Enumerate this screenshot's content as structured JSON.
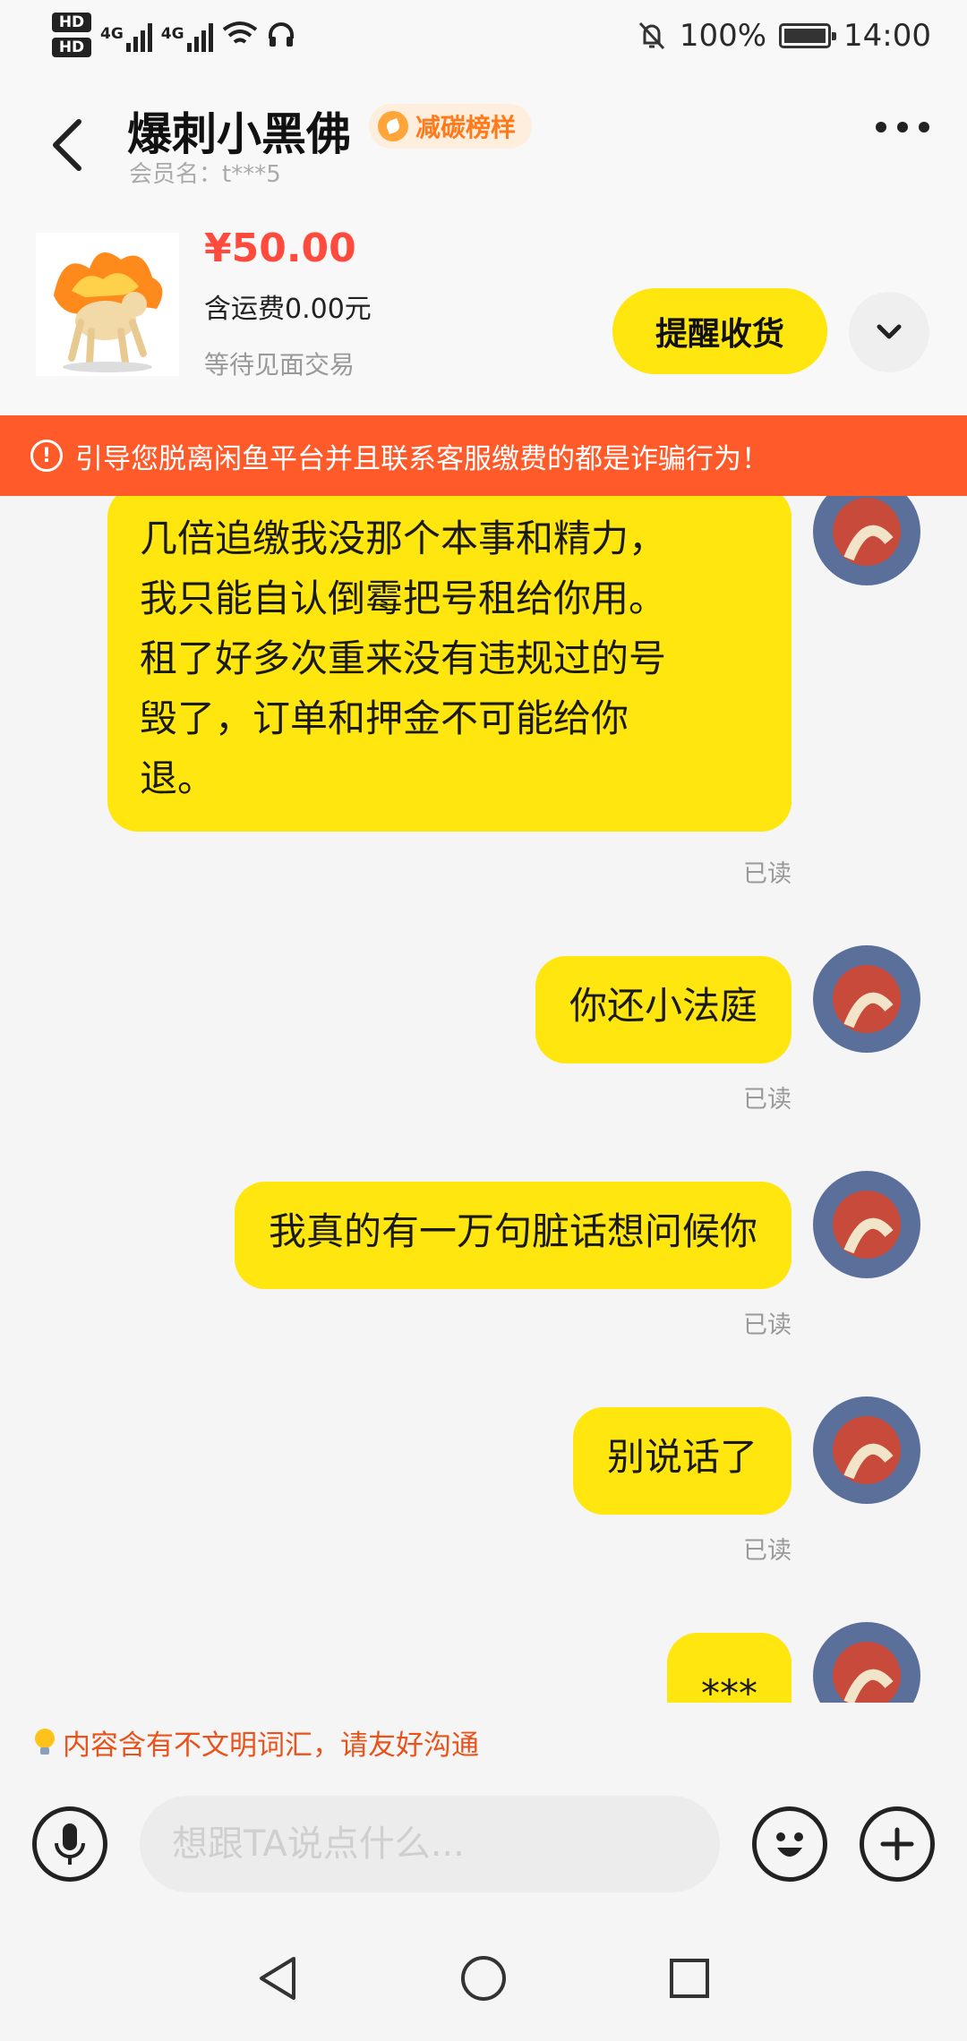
{
  "status_bar": {
    "hd1": "HD",
    "hd2": "HD",
    "net1": "4G",
    "net2": "4G",
    "battery": "100%",
    "time": "14:00"
  },
  "header": {
    "title": "爆刺小黑佛",
    "badge": "减碳榜样",
    "member_name": "会员名：t***5"
  },
  "product": {
    "price": "¥50.00",
    "shipping": "含运费0.00元",
    "status": "等待见面交易",
    "remind_button": "提醒收货"
  },
  "warning_banner": "引导您脱离闲鱼平台并且联系客服缴费的都是诈骗行为！",
  "messages": [
    {
      "text": "几倍追缴我没那个本事和精力，\n我只能自认倒霉把号租给你用。\n租了好多次重来没有违规过的号\n毁了，订单和押金不可能给你\n退。",
      "read": "已读"
    },
    {
      "text": "你还小法庭",
      "read": "已读"
    },
    {
      "text": "我真的有一万句脏话想问候你",
      "read": "已读"
    },
    {
      "text": "别说话了",
      "read": "已读"
    },
    {
      "text": "***",
      "read": ""
    }
  ],
  "notice": "内容含有不文明词汇，请友好沟通",
  "input": {
    "placeholder": "想跟TA说点什么..."
  },
  "colors": {
    "bubble": "#ffe60f",
    "price": "#ff4a3d",
    "warning": "#ff5a2a",
    "notice": "#e9531b",
    "badge_text": "#ff7a1a"
  }
}
